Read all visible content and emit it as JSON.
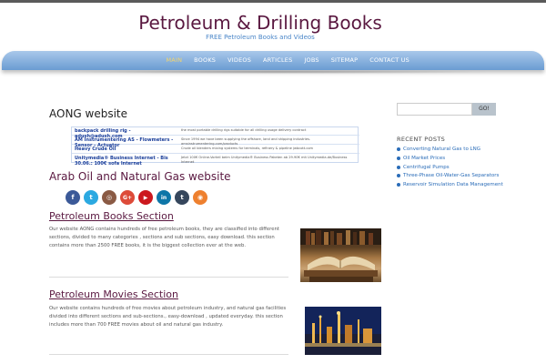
{
  "site": {
    "title": "Petroleum & Drilling Books",
    "tagline": "FREE Petroleum Books and Videos"
  },
  "nav": {
    "items": [
      {
        "label": "MAIN",
        "active": true
      },
      {
        "label": "BOOKS",
        "active": false
      },
      {
        "label": "VIDEOS",
        "active": false
      },
      {
        "label": "ARTICLES",
        "active": false
      },
      {
        "label": "JOBS",
        "active": false
      },
      {
        "label": "SITEMAP",
        "active": false
      },
      {
        "label": "CONTACT US",
        "active": false
      }
    ],
    "active_color": "#f3d46b"
  },
  "main": {
    "title": "AONG website",
    "ads": [
      {
        "link": "backpack drilling rig - adush@adush.com",
        "desc": "the most portable drilling rigs suitable for all drilling usage delivery contract"
      },
      {
        "link": "AM Instrumentering AS - Flowmeters - Sensor - Actuator",
        "desc": "Since 1994 we have been supplying the offshore, land and shipping industries. amsinstrumentering.com/products"
      },
      {
        "link": "Heavy Crude Oil",
        "desc": "Crude oil blenders mixing systems for terminals, refinery & pipeline jwbcott.com"
      },
      {
        "link": "Unitymedia® Business Internet - Bis 30.06.: 100€ sofa Internet",
        "desc": "Jetzt 100€ Online-Vorteil beim Unitymedia® Business Paketen ab 29.90€ mit Unitymedia.de/Business Internet"
      }
    ],
    "section_heading": "Arab Oil and Natural Gas website",
    "social_icons": [
      {
        "name": "facebook-icon",
        "glyph": "f",
        "color": "#3b5998"
      },
      {
        "name": "twitter-icon",
        "glyph": "t",
        "color": "#2ba9e1"
      },
      {
        "name": "instagram-icon",
        "glyph": "◎",
        "color": "#8a5a44"
      },
      {
        "name": "google-plus-icon",
        "glyph": "G+",
        "color": "#dd4b39"
      },
      {
        "name": "youtube-icon",
        "glyph": "▶",
        "color": "#cc181e"
      },
      {
        "name": "linkedin-icon",
        "glyph": "in",
        "color": "#0e76a8"
      },
      {
        "name": "tumblr-icon",
        "glyph": "t",
        "color": "#35465c"
      },
      {
        "name": "rss-icon",
        "glyph": "◉",
        "color": "#ee802f"
      }
    ],
    "sections": [
      {
        "title": "Petroleum Books Section",
        "text": "Our website AONG contains hundreds of free petroleum books, they are classified into different sections, divided to many categories , sections and sub sections, easy download. this section contains more than 2500 FREE books, it is the biggest collection ever at the web."
      },
      {
        "title": "Petroleum Movies Section",
        "text": "Our website contains hundreds of free movies about petroleum industry, and natural gas facilities divided into different sections and sub-sections., easy-download , updated everyday. this section includes more than 700 FREE movies about oil and natural gas industry."
      }
    ]
  },
  "sidebar": {
    "search_button": "GO!",
    "search_value": "",
    "recent_title": "RECENT POSTS",
    "recent_posts": [
      "Converting Natural Gas to LNG",
      "Oil Market Prices",
      "Centrifugal Pumps",
      "Three-Phase Oil-Water-Gas Separators",
      "Reservoir Simulation Data Management"
    ]
  }
}
